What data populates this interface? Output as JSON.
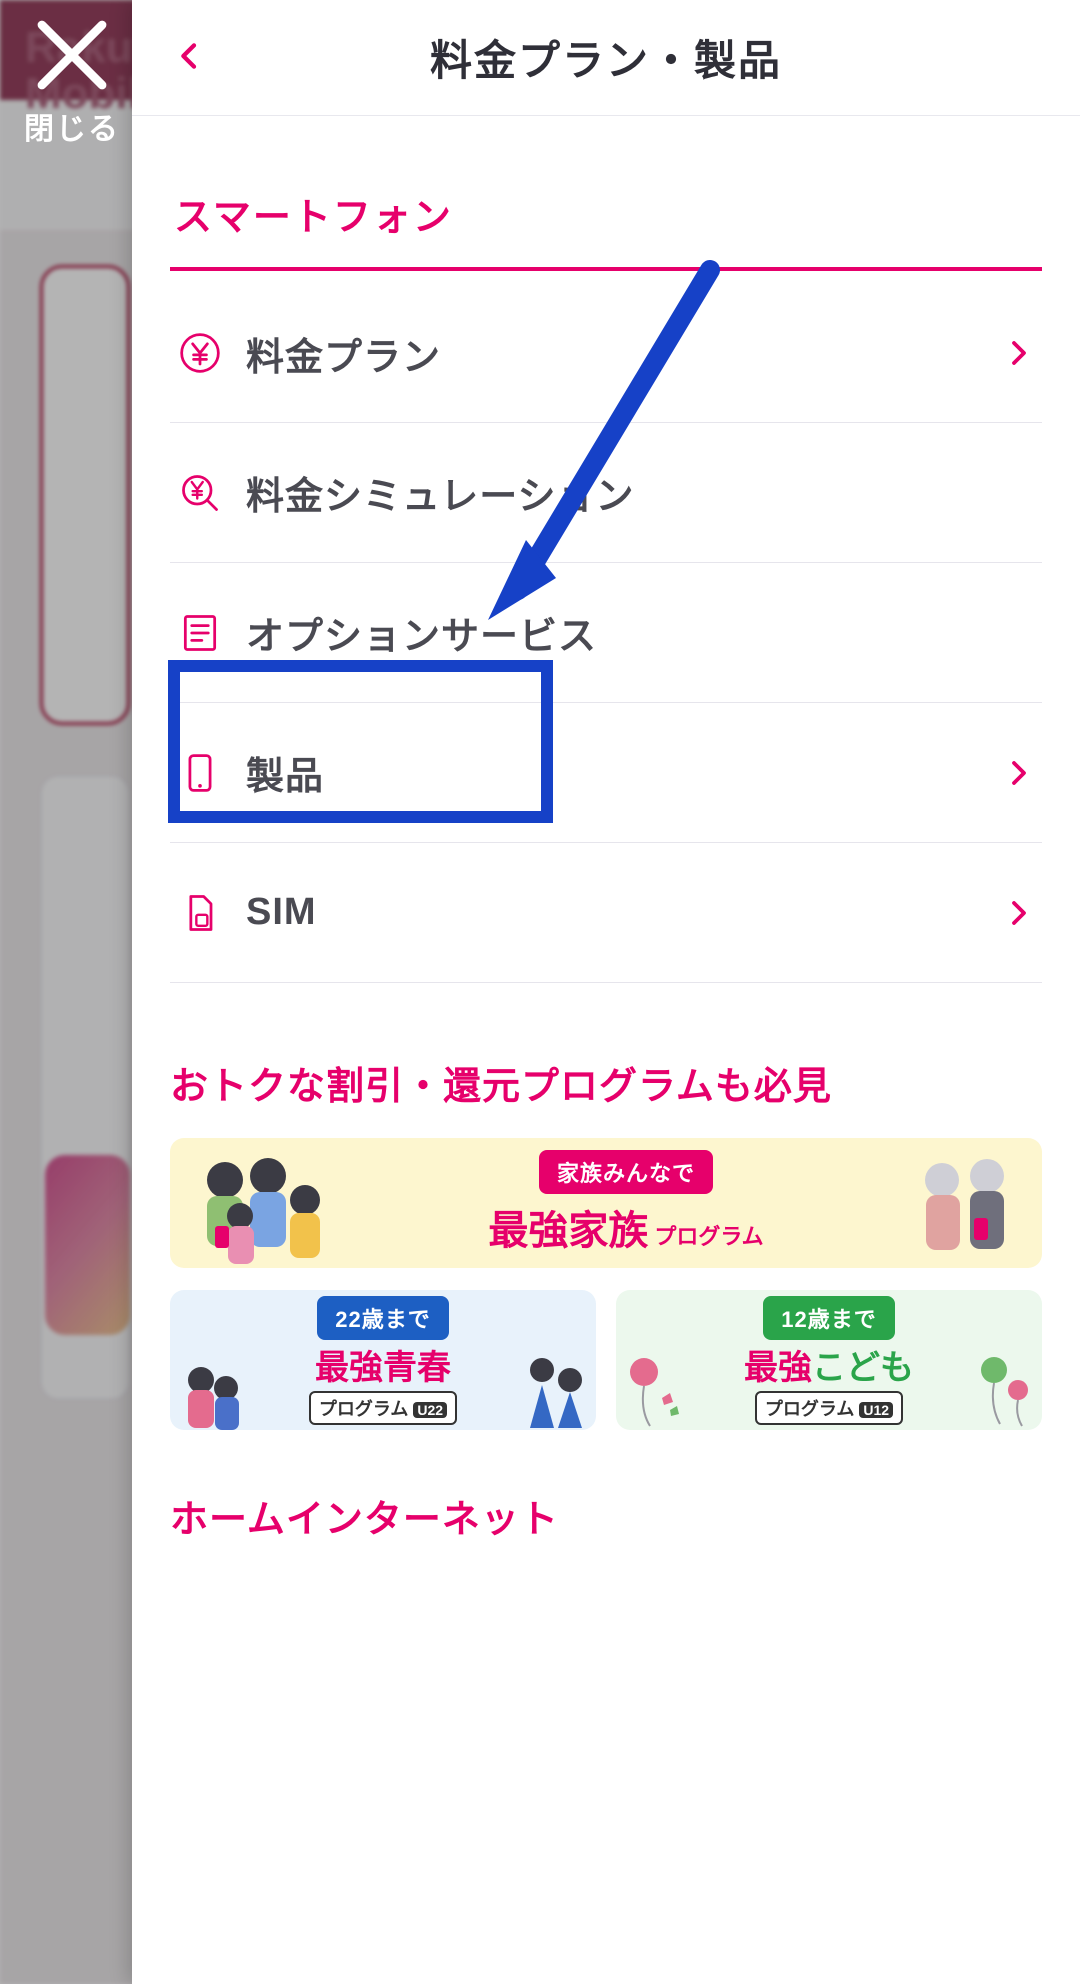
{
  "close": {
    "label": "閉じる"
  },
  "bg": {
    "logo_line1": "Rakuten",
    "logo_line2": "Mobile"
  },
  "panel": {
    "title": "料金プラン・製品",
    "section1_title": "スマートフォン",
    "menu": [
      {
        "key": "plan",
        "label": "料金プラン",
        "icon": "yen-circle-icon",
        "chevron": true
      },
      {
        "key": "simulation",
        "label": "料金シミュレーション",
        "icon": "yen-search-icon",
        "chevron": false
      },
      {
        "key": "option",
        "label": "オプションサービス",
        "icon": "list-doc-icon",
        "chevron": false
      },
      {
        "key": "product",
        "label": "製品",
        "icon": "smartphone-icon",
        "chevron": true
      },
      {
        "key": "sim",
        "label": "SIM",
        "icon": "sim-card-icon",
        "chevron": true
      }
    ],
    "section2_title": "おトクな割引・還元プログラムも必見",
    "promo_family": {
      "pill": "家族みんなで",
      "strong": "最強家族",
      "suffix": "プログラム"
    },
    "promo_youth": {
      "pill": "22歳まで",
      "strong": "最強青春",
      "sub": "プログラム",
      "badge": "U22"
    },
    "promo_kids": {
      "pill": "12歳まで",
      "strong_a": "最強",
      "strong_b": "こども",
      "sub": "プログラム",
      "badge": "U12"
    },
    "section3_title": "ホームインターネット"
  },
  "colors": {
    "brand": "#e6006b",
    "annot": "#1641c7"
  }
}
